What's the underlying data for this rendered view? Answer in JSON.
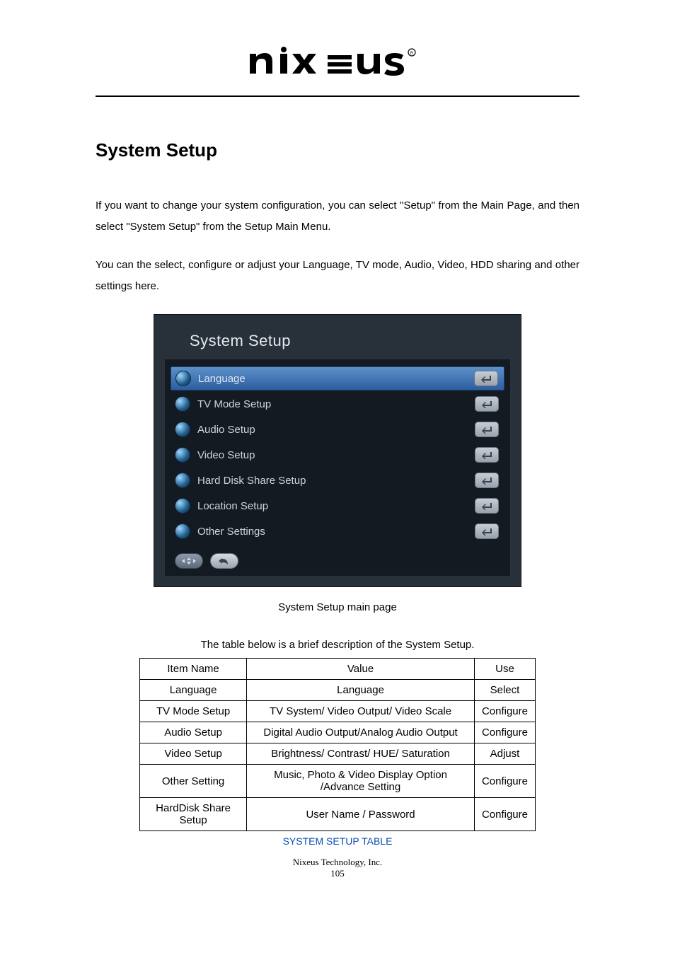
{
  "logo_text": "nixeus",
  "heading": "System Setup",
  "paragraph1": "If you want to change your system configuration, you can select \"Setup\" from the Main Page, and then select \"System Setup\" from the Setup Main Menu.",
  "paragraph2": "You can the select, configure or adjust your Language, TV mode, Audio, Video, HDD sharing and other settings here.",
  "screenshot": {
    "title": "System Setup",
    "items": [
      {
        "label": "Language",
        "selected": true
      },
      {
        "label": "TV Mode Setup",
        "selected": false
      },
      {
        "label": "Audio Setup",
        "selected": false
      },
      {
        "label": "Video Setup",
        "selected": false
      },
      {
        "label": "Hard Disk Share Setup",
        "selected": false
      },
      {
        "label": "Location Setup",
        "selected": false
      },
      {
        "label": "Other Settings",
        "selected": false
      }
    ]
  },
  "caption": "System Setup main page",
  "table_intro": "The table below is a brief description of the System Setup.",
  "table": {
    "headers": {
      "c1": "Item Name",
      "c2": "Value",
      "c3": "Use"
    },
    "rows": [
      {
        "c1": "Language",
        "c2": "Language",
        "c3": "Select"
      },
      {
        "c1": "TV Mode Setup",
        "c2": "TV System/ Video Output/ Video Scale",
        "c3": "Configure"
      },
      {
        "c1": "Audio Setup",
        "c2": "Digital Audio Output/Analog Audio Output",
        "c3": "Configure"
      },
      {
        "c1": "Video Setup",
        "c2": "Brightness/ Contrast/ HUE/ Saturation",
        "c3": "Adjust"
      },
      {
        "c1": "Other Setting",
        "c2": "Music, Photo & Video Display Option /Advance Setting",
        "c3": "Configure"
      },
      {
        "c1": "HardDisk Share Setup",
        "c2": "User Name / Password",
        "c3": "Configure"
      }
    ],
    "caption": "SYSTEM SETUP TABLE"
  },
  "footer": {
    "company": "Nixeus Technology, Inc.",
    "page": "105"
  }
}
